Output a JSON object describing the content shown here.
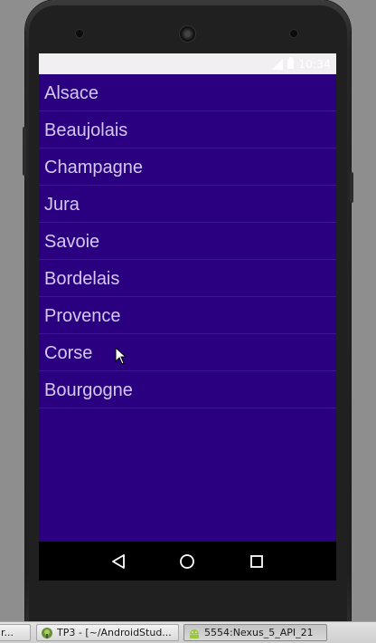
{
  "status_bar": {
    "time": "10:34",
    "icons": [
      "signal-icon",
      "battery-icon"
    ]
  },
  "list": {
    "items": [
      "Alsace",
      "Beaujolais",
      "Champagne",
      "Jura",
      "Savoie",
      "Bordelais",
      "Provence",
      "Corse",
      "Bourgogne"
    ]
  },
  "nav_bar": {
    "buttons": [
      "back-icon",
      "home-icon",
      "recents-icon"
    ]
  },
  "taskbar": {
    "tasks": [
      {
        "label": "r...",
        "icon": "app-icon"
      },
      {
        "label": "TP3 - [~/AndroidStud...",
        "icon": "android-studio-icon"
      },
      {
        "label": "5554:Nexus_5_API_21",
        "icon": "android-emulator-icon"
      }
    ]
  },
  "colors": {
    "app_background": "#2a0080",
    "list_text": "#d3c9ef",
    "status_bar": "#f1eff1",
    "nav_bar": "#000000"
  }
}
